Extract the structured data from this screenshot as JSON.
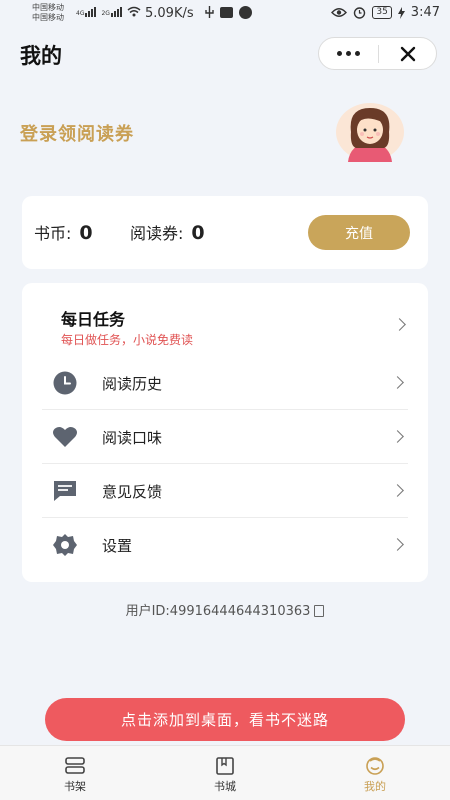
{
  "status_bar": {
    "carrier_1": "中国移动",
    "carrier_2": "中国移动",
    "net_1": "4G",
    "net_2": "2G",
    "speed": "5.09K/s",
    "battery": "35",
    "time": "3:47"
  },
  "header": {
    "title": "我的"
  },
  "profile": {
    "login_prompt": "登录领阅读券"
  },
  "wallet": {
    "coins_label": "书币:",
    "coins_value": "0",
    "coupons_label": "阅读券:",
    "coupons_value": "0",
    "recharge_label": "充值"
  },
  "menu": {
    "daily_task": {
      "title": "每日任务",
      "subtitle": "每日做任务，小说免费读"
    },
    "items": [
      {
        "label": "阅读历史",
        "icon": "clock-icon"
      },
      {
        "label": "阅读口味",
        "icon": "heart-icon"
      },
      {
        "label": "意见反馈",
        "icon": "feedback-icon"
      },
      {
        "label": "设置",
        "icon": "settings-icon"
      }
    ]
  },
  "user_id": "用户ID:49916444644310363",
  "cta": "点击添加到桌面，看书不迷路",
  "tabs": [
    {
      "label": "书架",
      "icon": "bookshelf-icon",
      "active": false
    },
    {
      "label": "书城",
      "icon": "bookstore-icon",
      "active": false
    },
    {
      "label": "我的",
      "icon": "profile-icon",
      "active": true
    }
  ],
  "colors": {
    "accent_gold": "#c9a055",
    "cta_red": "#ee5a5f",
    "task_red": "#e05353",
    "background": "#f1f4f9"
  }
}
